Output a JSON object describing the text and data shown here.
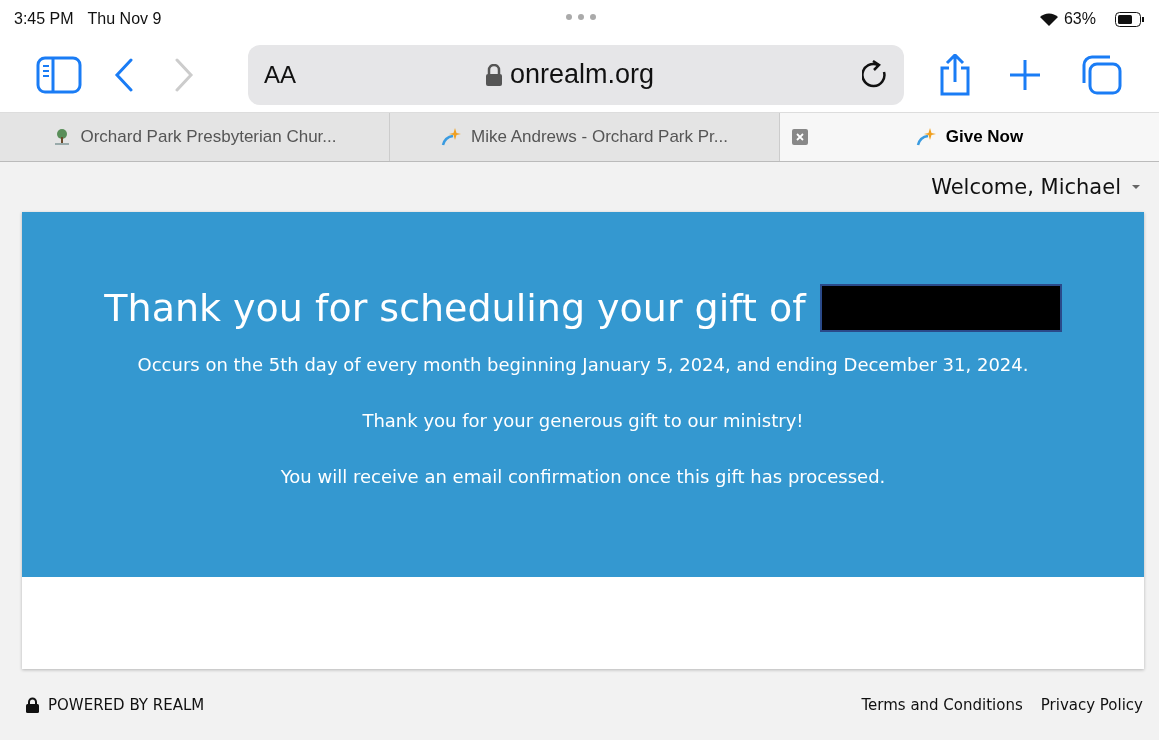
{
  "status_bar": {
    "time": "3:45 PM",
    "date": "Thu Nov 9",
    "battery": "63%"
  },
  "toolbar": {
    "text_size": "AA",
    "address": "onrealm.org"
  },
  "tabs": [
    {
      "label": "Orchard Park Presbyterian Chur...",
      "kind": "tree",
      "selected": false
    },
    {
      "label": "Mike Andrews - Orchard Park Pr...",
      "kind": "sparkle",
      "selected": false
    },
    {
      "label": "Give Now",
      "kind": "sparkle",
      "selected": true
    }
  ],
  "user_menu": {
    "label": "Welcome, Michael"
  },
  "confirmation": {
    "heading": "Thank you for scheduling your gift of",
    "amount_redacted": true,
    "lines": [
      "Occurs on the 5th day of every month beginning January 5, 2024, and ending December 31, 2024.",
      "Thank you for your generous gift to our ministry!",
      "You will receive an email confirmation once this gift has processed."
    ]
  },
  "footer": {
    "powered_by": "POWERED BY REALM",
    "links": [
      "Terms and Conditions",
      "Privacy Policy"
    ]
  }
}
